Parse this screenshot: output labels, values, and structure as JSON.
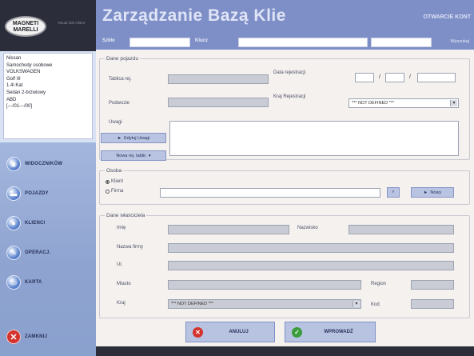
{
  "header": {
    "title": "Zarządzanie Bazą Klie",
    "right_label": "OTWARCIE KONT",
    "row_label_1": "Szkło",
    "row_label_2": "Klucz",
    "row_right": "Wyszukaj"
  },
  "logo": {
    "text": "MAGNETI MARELLI",
    "sub": "Visual 200\nClient"
  },
  "info_panel": {
    "lines": [
      "Nissan",
      "Samochody osobowe",
      "VOLKSWAGEN",
      "Golf III",
      "1.4i Kat",
      "Sedan 2-brzwiowy",
      "ABD",
      "[---/01---/00]"
    ]
  },
  "nav": {
    "items": [
      {
        "label": "WIDOCZNIKÓW"
      },
      {
        "label": "POJAZDY"
      },
      {
        "label": "KLIENCI"
      },
      {
        "label": "OPERACJ."
      },
      {
        "label": "KARTA"
      }
    ],
    "exit_label": "ZAMKNIJ"
  },
  "vehicle": {
    "legend": "Dane pojazdu",
    "plate_label": "Tablica rej.",
    "reg_date_label": "Data rejestracji",
    "chassis_label": "Podwozie",
    "country_label": "Kraj Rejestracji",
    "country_value": "*** NOT DEFINED ***",
    "notes_label": "Uwagi",
    "edit_notes_button": "Edytuj Uwagi",
    "new_plate_button": "Nowa rej. tablic"
  },
  "owner": {
    "legend": "Osoba",
    "radio_private": "Klient",
    "radio_company": "Firma",
    "new_button": "Nowy"
  },
  "owner_data": {
    "legend": "Dane właściciela",
    "first_name_label": "Imię",
    "surname_label": "Nazwisko",
    "company_label": "Nazwa firmy",
    "street_label": "Ul.",
    "city_label": "Miasto",
    "region_label": "Region",
    "country_label": "Kraj",
    "country_value": "*** NOT DEFINED ***",
    "postcode_label": "Kod"
  },
  "actions": {
    "cancel": "ANULUJ",
    "confirm": "WPROWADŹ"
  },
  "colors": {
    "accent": "#7e8fc7",
    "sidebar": "#8ea3d0",
    "exit": "#d4322d",
    "confirm": "#3a9c3a"
  }
}
